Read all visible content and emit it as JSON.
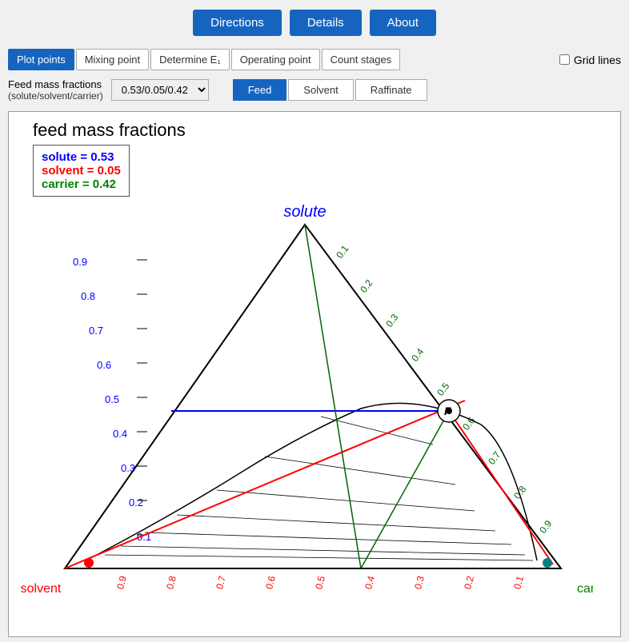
{
  "topButtons": {
    "directions": "Directions",
    "details": "Details",
    "about": "About"
  },
  "tabs": [
    {
      "label": "Plot points",
      "active": true
    },
    {
      "label": "Mixing point",
      "active": false
    },
    {
      "label": "Determine E₁",
      "active": false
    },
    {
      "label": "Operating point",
      "active": false
    },
    {
      "label": "Count stages",
      "active": false
    }
  ],
  "gridLines": "Grid lines",
  "feedLabel": "Feed mass fractions\n(solute/solvent/carrier)",
  "feedDropdown": "0.53/0.05/0.42",
  "fracButtons": [
    "Feed",
    "Solvent",
    "Raffinate"
  ],
  "chart": {
    "title": "feed mass fractions",
    "solute_label": "solute = 0.53",
    "solvent_label": "solvent = 0.05",
    "carrier_label": "carrier = 0.42",
    "vertex_top": "solute",
    "vertex_bl": "solvent",
    "vertex_br": "carrier"
  }
}
